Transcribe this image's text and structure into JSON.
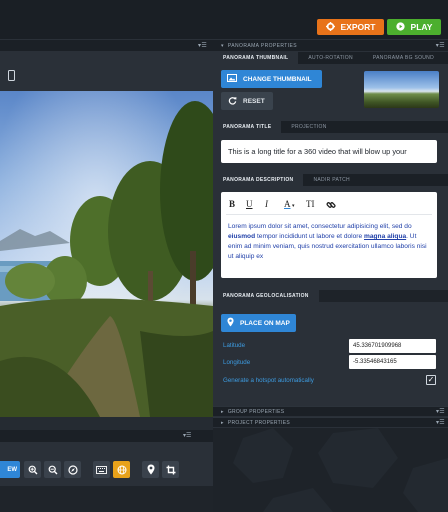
{
  "topbar": {
    "export_label": "EXPORT",
    "play_label": "PLAY",
    "colors": {
      "export": "#e8731a",
      "play": "#4caf2e"
    }
  },
  "panorama_properties": {
    "title": "PANORAMA PROPERTIES",
    "thumbnail_tabs": [
      "PANORAMA THUMBNAIL",
      "AUTO-ROTATION",
      "PANORAMA BG SOUND"
    ],
    "change_thumbnail_label": "CHANGE THUMBNAIL",
    "reset_label": "RESET",
    "title_tabs": [
      "PANORAMA TITLE",
      "PROJECTION"
    ],
    "title_value": "This is a long title for a 360 video that will blow up your",
    "description_tabs": [
      "PANORAMA DESCRIPTION",
      "NADIR PATCH"
    ],
    "description": {
      "part1": "Lorem ipsum dolor sit amet, consectetur adipisicing elit, sed do ",
      "bold": "eiusmod",
      "part2": " tempor incididunt ut labore et dolore ",
      "link": "magna aliqua",
      "part3": ". Ut enim ad minim veniam, quis nostrud exercitation ullamco laboris nisi ut aliquip ex"
    },
    "editor_tools": [
      "B",
      "U",
      "I",
      "A",
      "TI"
    ],
    "geo_tab": "PANORAMA GEOLOCALISATION",
    "place_on_map_label": "PLACE ON MAP",
    "latitude_label": "Latitude",
    "latitude_value": "45.336701909968",
    "longitude_label": "Longitude",
    "longitude_value": "-5.33546843165",
    "hotspot_label": "Generate a hotspot automatically",
    "hotspot_checked": true
  },
  "collapsed_sections": {
    "group": "GROUP PROPERTIES",
    "project": "PROJECT PROPERTIES"
  },
  "viewer": {
    "view_button_label": "EW",
    "tools": [
      "zoom-in-icon",
      "zoom-out-icon",
      "compass-icon",
      "keyboard-icon",
      "globe-icon",
      "pin-icon",
      "crop-icon"
    ],
    "active_tool": "globe-icon"
  },
  "colors": {
    "accent_blue": "#2f86d6",
    "active_tool": "#e8a21a",
    "label_blue": "#3d9be0"
  }
}
